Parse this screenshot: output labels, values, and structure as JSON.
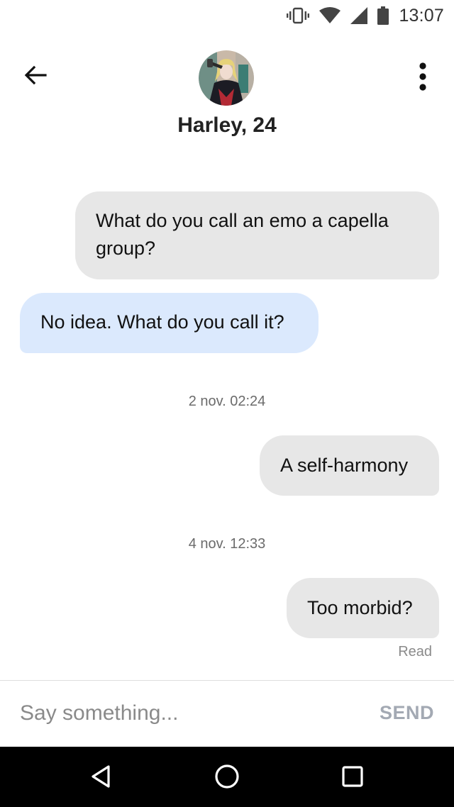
{
  "status_bar": {
    "time": "13:07",
    "icons": [
      "vibrate-icon",
      "wifi-icon",
      "cell-signal-icon",
      "battery-icon"
    ]
  },
  "header": {
    "back_icon": "arrow-left-icon",
    "contact_name": "Harley, 24",
    "avatar": "profile-photo",
    "menu_icon": "more-vertical-icon"
  },
  "conversation": {
    "messages": [
      {
        "direction": "outgoing",
        "text": "What do you call an emo a capella group?"
      },
      {
        "direction": "incoming",
        "text": "No idea. What do you call it?"
      },
      {
        "direction": "outgoing",
        "text": "A self-harmony"
      },
      {
        "direction": "outgoing",
        "text": "Too morbid?"
      }
    ],
    "timestamps": [
      "2 nov. 02:24",
      "4 nov. 12:33"
    ],
    "read_receipt": "Read"
  },
  "composer": {
    "placeholder": "Say something...",
    "value": "",
    "send_label": "SEND"
  },
  "nav_bar": {
    "icons": [
      "nav-back-icon",
      "nav-home-icon",
      "nav-recents-icon"
    ]
  },
  "colors": {
    "outgoing_bubble": "#e7e7e7",
    "incoming_bubble": "#dbe9fd",
    "send_disabled": "#a3a9b3",
    "nav_bar": "#000000"
  }
}
